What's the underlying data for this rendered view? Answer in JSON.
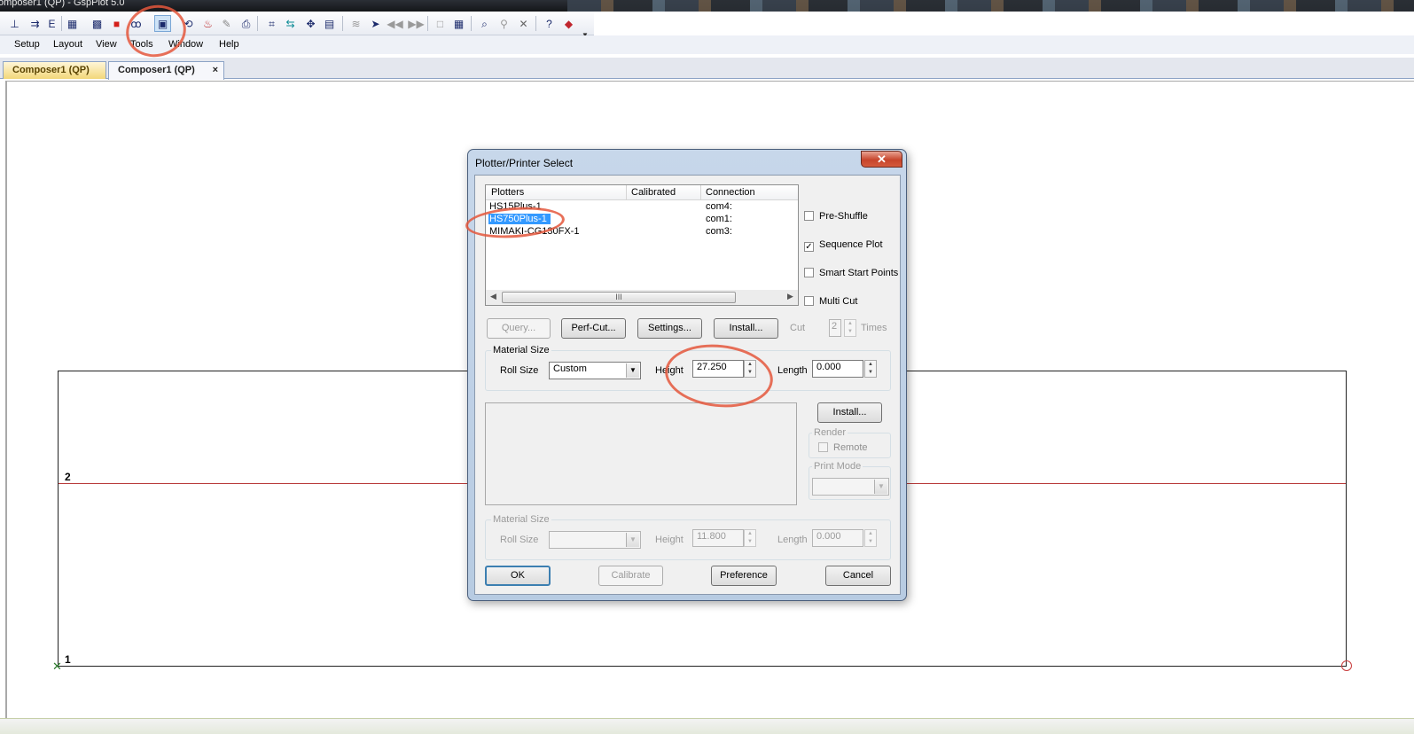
{
  "window": {
    "title": "omposer1 (QP) - GspPlot 5.0"
  },
  "toolbar": {
    "overflow_icon": "chevron-down-icon",
    "icons": [
      "plot-setup-icon",
      "nest-icon",
      "text-edit-icon",
      "grid-icon",
      "dots-grid-icon",
      "fill-color-icon",
      "glasses-icon",
      "plotter-select-icon",
      "rotate-icon",
      "mirror-icon",
      "paint-icon",
      "preview-icon",
      "weed-border-icon",
      "register-mark-icon",
      "move-icon",
      "frame-icon",
      "layers-icon",
      "select-arrow-icon",
      "rewind-icon",
      "forward-icon",
      "box-select-icon",
      "table-grid-icon",
      "zoom-icon",
      "path-icon",
      "cross-tools-icon",
      "help-pointer-icon",
      "eraser-icon"
    ]
  },
  "menu": {
    "items": [
      "Setup",
      "Layout",
      "View",
      "Tools",
      "Window",
      "Help"
    ]
  },
  "tabs": [
    {
      "label": "Composer1 (QP)"
    },
    {
      "label": "Composer1 (QP)",
      "close": "×"
    }
  ],
  "canvas": {
    "edge_labels": [
      "2",
      "1"
    ],
    "markers": {
      "origin": "✕"
    }
  },
  "dialog": {
    "title": "Plotter/Printer Select",
    "close_glyph": "✕",
    "plotter_list": {
      "columns": [
        "Plotters",
        "Calibrated",
        "Connection"
      ],
      "rows": [
        {
          "name": "HS15Plus-1",
          "calibrated": "",
          "connection": "com4:",
          "selected": false
        },
        {
          "name": "HS750Plus-1",
          "calibrated": "",
          "connection": "com1:",
          "selected": true
        },
        {
          "name": "MIMAKI-CG130FX-1",
          "calibrated": "",
          "connection": "com3:",
          "selected": false
        }
      ],
      "scroll_grip": "III"
    },
    "checkboxes": [
      {
        "label": "Pre-Shuffle",
        "checked": false
      },
      {
        "label": "Sequence Plot",
        "checked": true,
        "mark": "✓"
      },
      {
        "label": "Smart Start Points",
        "checked": false
      },
      {
        "label": "Multi Cut",
        "checked": false
      }
    ],
    "buttons": {
      "query": "Query...",
      "perf_cut": "Perf-Cut...",
      "settings": "Settings...",
      "install": "Install...",
      "install2": "Install...",
      "ok": "OK",
      "calibrate": "Calibrate",
      "preference": "Preference",
      "cancel": "Cancel"
    },
    "cut": {
      "label": "Cut",
      "value": "2",
      "suffix": "Times"
    },
    "material_size": {
      "title": "Material Size",
      "roll_size_label": "Roll Size",
      "roll_size_value": "Custom",
      "height_label": "Height",
      "height_value": "27.250",
      "length_label": "Length",
      "length_value": "0.000"
    },
    "render": {
      "title": "Render",
      "remote_label": "Remote"
    },
    "print_mode": {
      "title": "Print Mode"
    },
    "material_size_2": {
      "title": "Material Size",
      "roll_size_label": "Roll Size",
      "height_label": "Height",
      "height_value": "11.800",
      "length_label": "Length",
      "length_value": "0.000"
    }
  },
  "colors": {
    "annotation": "#e4573c",
    "selection": "#3399ff",
    "guide_line": "#b83a3a"
  }
}
